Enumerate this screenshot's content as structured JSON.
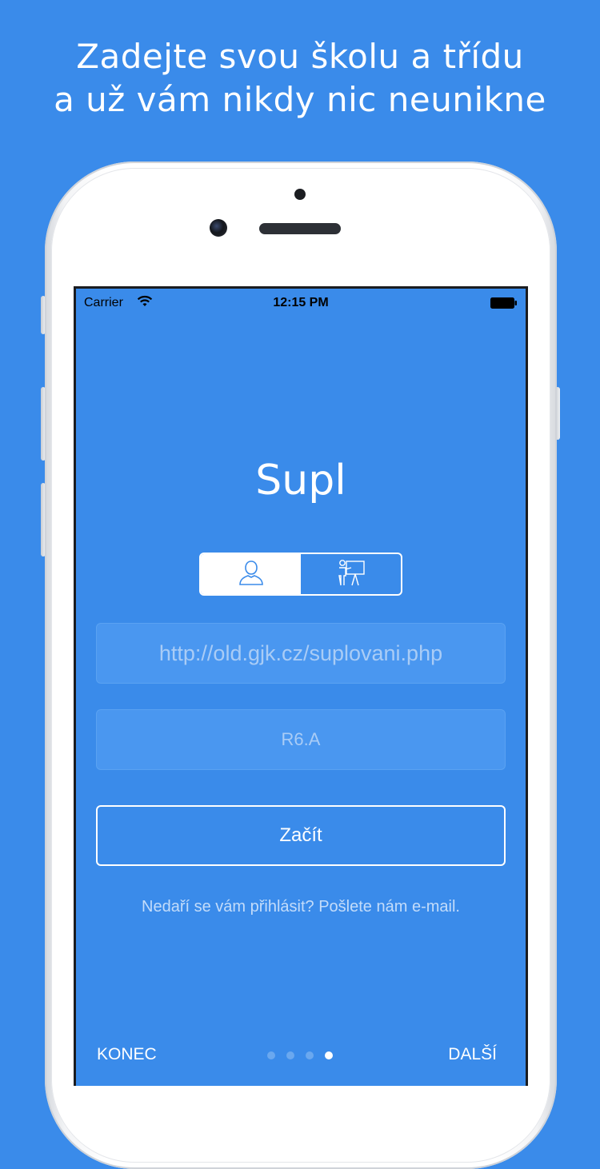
{
  "headline": {
    "line1": "Zadejte svou školu a třídu",
    "line2": "a už vám nikdy nic neunikne"
  },
  "colors": {
    "background": "#3a8bea",
    "field": "#4a97f0",
    "text": "#ffffff",
    "placeholder": "#a9ccf6"
  },
  "status_bar": {
    "carrier": "Carrier",
    "time": "12:15 PM",
    "wifi_icon": "wifi-icon",
    "battery_icon": "battery-icon"
  },
  "app": {
    "title": "Supl",
    "segments": [
      {
        "icon": "student-icon",
        "selected": true
      },
      {
        "icon": "teacher-icon",
        "selected": false
      }
    ],
    "url_placeholder": "http://old.gjk.cz/suplovani.php",
    "class_placeholder": "R6.A",
    "start_label": "Začít",
    "help_text": "Nedaří se vám přihlásit? Pošlete nám e-mail."
  },
  "bottom_nav": {
    "left_label": "KONEC",
    "right_label": "DALŠÍ",
    "page_count": 4,
    "current_page": 4
  }
}
